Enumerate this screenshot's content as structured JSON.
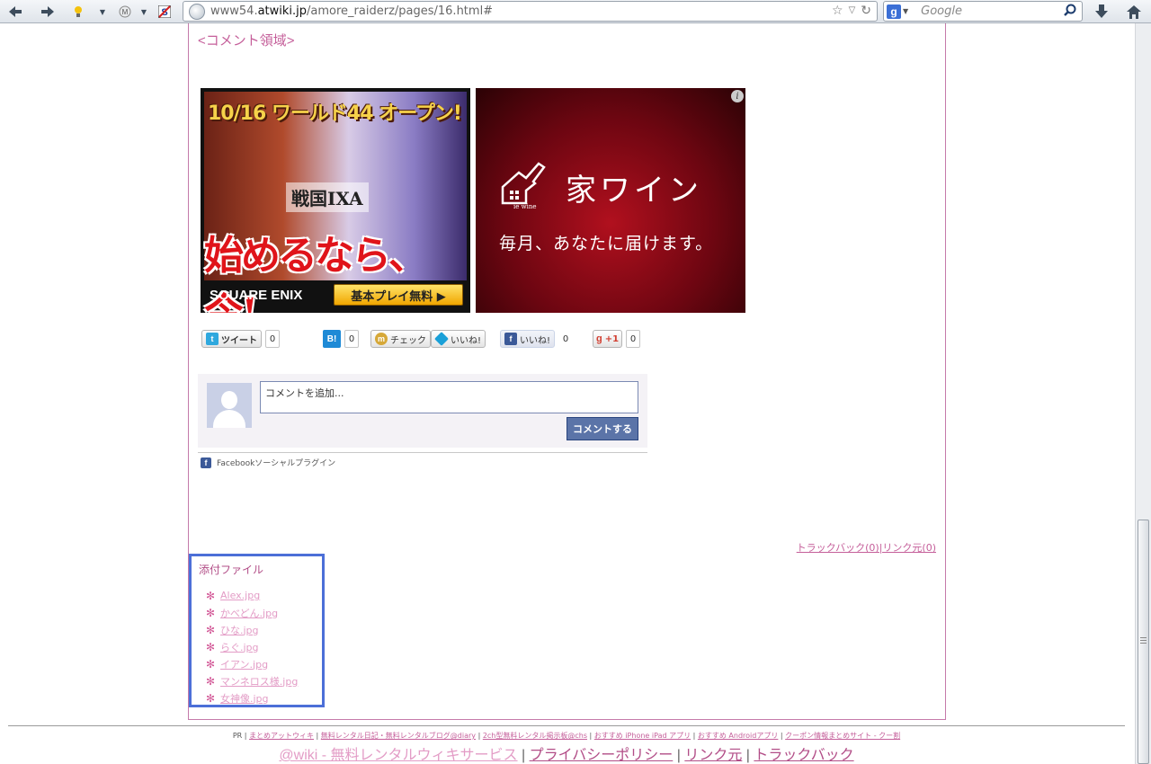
{
  "browser": {
    "url_prefix": "www54.",
    "url_domain": "atwiki.jp",
    "url_path": "/amore_raiderz/pages/16.html#",
    "search_placeholder": "Google",
    "search_engine_glyph": "g"
  },
  "page": {
    "comment_area_link": "<コメント領域>",
    "ads": {
      "ad1": {
        "headline": "10/16 ワールド44 オープン!",
        "logo": "戦国IXA",
        "main_text": "始めるなら、今!",
        "brand": "SQUARE ENIX",
        "cta": "基本プレイ無料 ▶"
      },
      "ad2": {
        "info": "i",
        "title": "家ワイン",
        "brand_small": "ie wine",
        "subtitle": "毎月、あなたに届けます。"
      }
    },
    "share": {
      "tweet": {
        "label": "ツイート",
        "count": "0"
      },
      "hatena": {
        "label": "B!",
        "count": "0"
      },
      "mixi_check": {
        "label": "チェック"
      },
      "mixi_like": {
        "label": "いいね!"
      },
      "facebook_like": {
        "label": "いいね!",
        "count": "0"
      },
      "gplus": {
        "label": "+1",
        "count": "0"
      }
    },
    "facebook_comments": {
      "placeholder": "コメントを追加...",
      "submit": "コメントする",
      "plugin_label": "Facebookソーシャルプラグイン"
    },
    "trackback_link": "トラックバック(0)|リンク元(0)",
    "attached_files": {
      "title": "添付ファイル",
      "bullet": "✻",
      "files": [
        "Alex.jpg",
        "かべどん.jpg",
        "ひな.jpg",
        "らぐ.jpg",
        "イアン.jpg",
        "マンネロス様.jpg",
        "女神像.jpg"
      ]
    }
  },
  "footer": {
    "pr": "PR",
    "links": [
      "まとめアットウィキ",
      "無料レンタル日記・無料レンタルブログ@diary",
      "2ch型無料レンタル掲示板@chs",
      "おすすめ iPhone iPad アプリ",
      "おすすめ Androidアプリ",
      "クーポン情報まとめサイト - クー割"
    ],
    "main_links": [
      "@wiki - 無料レンタルウィキサービス",
      "プライバシーポリシー",
      "リンク元",
      "トラックバック"
    ]
  },
  "colors": {
    "accent": "#c55f9a",
    "files_box_border": "#4c6fd8",
    "fb_button": "#5b74a8"
  }
}
